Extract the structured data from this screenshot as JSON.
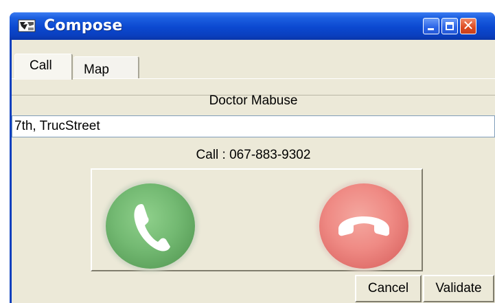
{
  "window": {
    "title": "Compose",
    "icon": "compose-app-icon",
    "controls": [
      "minimize-icon",
      "maximize-icon",
      "close-icon"
    ]
  },
  "tabs": [
    {
      "label": "Call",
      "selected": true
    },
    {
      "label": "Map",
      "selected": false
    }
  ],
  "contact": {
    "name": "Doctor Mabuse",
    "address": "7th, TrucStreet",
    "call_text": "Call : 067-883-9302"
  },
  "actions": {
    "accept_icon": "phone-accept-icon",
    "reject_icon": "phone-hangup-icon",
    "cancel_label": "Cancel",
    "validate_label": "Validate"
  },
  "colors": {
    "titlebar": "#0a3fbe",
    "face": "#ece9d8",
    "accept": "#73b972",
    "reject": "#ef8a84",
    "close_button": "#dd4a20"
  }
}
